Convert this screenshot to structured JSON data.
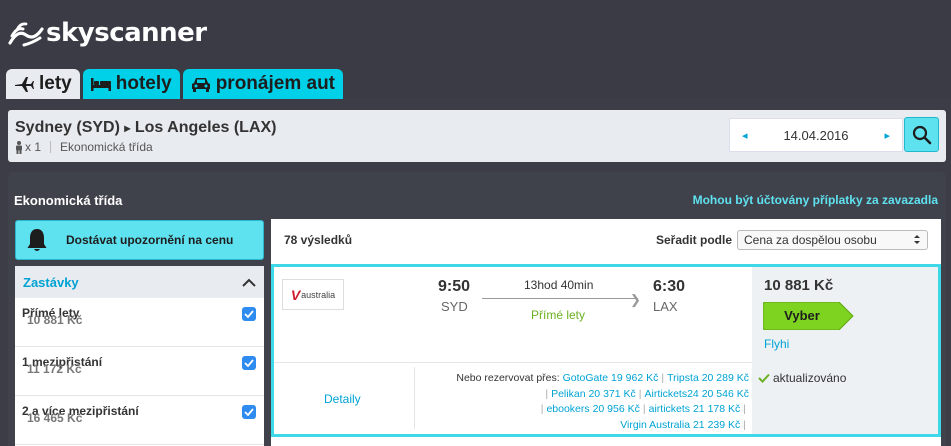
{
  "brand": {
    "name": "skyscanner"
  },
  "tabs": [
    {
      "label": "lety",
      "icon": "plane-icon",
      "active": true
    },
    {
      "label": "hotely",
      "icon": "bed-icon",
      "active": false
    },
    {
      "label": "pronájem aut",
      "icon": "car-icon",
      "active": false
    }
  ],
  "search": {
    "from": "Sydney (SYD)",
    "arrow": "▸",
    "to": "Los Angeles (LAX)",
    "passengers": "x 1",
    "cabin": "Ekonomická třída",
    "date": "14.04.2016",
    "prev": "◂",
    "next": "▸"
  },
  "panel": {
    "title": "Ekonomická třída",
    "note": "Mohou být účtovány příplatky za zavazadla",
    "alert_label": "Dostávat upozornění na cenu"
  },
  "filters": {
    "title": "Zastávky",
    "items": [
      {
        "name": "Přímé lety",
        "price": "10 881 Kč"
      },
      {
        "name": "1 mezipřistání",
        "price": "11 172 Kč"
      },
      {
        "name": "2 a více mezipřistání",
        "price": "16 465 Kč"
      }
    ]
  },
  "results": {
    "count": "78 výsledků",
    "sort_label": "Seřadit podle",
    "sort_value": "Cena za dospělou osobu"
  },
  "flight": {
    "airline_logo_text": "australia",
    "airline_logo_mark": "V",
    "dep_time": "9:50",
    "dep_code": "SYD",
    "duration": "13hod 40min",
    "stops": "Přímé lety",
    "arr_time": "6:30",
    "arr_code": "LAX",
    "details": "Detaily",
    "other_label": "Nebo rezervovat přes:",
    "other_offers": [
      {
        "name": "GotoGate",
        "price": "19 962 Kč"
      },
      {
        "name": "Tripsta",
        "price": "20 289 Kč"
      },
      {
        "name": "Pelikan",
        "price": "20 371 Kč"
      },
      {
        "name": "Airtickets24",
        "price": "20 546 Kč"
      },
      {
        "name": "ebookers",
        "price": "20 956 Kč"
      },
      {
        "name": "airtickets",
        "price": "21 178 Kč"
      },
      {
        "name": "Virgin Australia",
        "price": "21 239 Kč"
      }
    ],
    "price": "10 881 Kč",
    "select_label": "Vyber",
    "provider": "Flyhi",
    "updated": "aktualizováno"
  },
  "colors": {
    "accent": "#00d0e8",
    "link": "#00a3d4",
    "select": "#7ed321",
    "header": "#3a3b44"
  }
}
